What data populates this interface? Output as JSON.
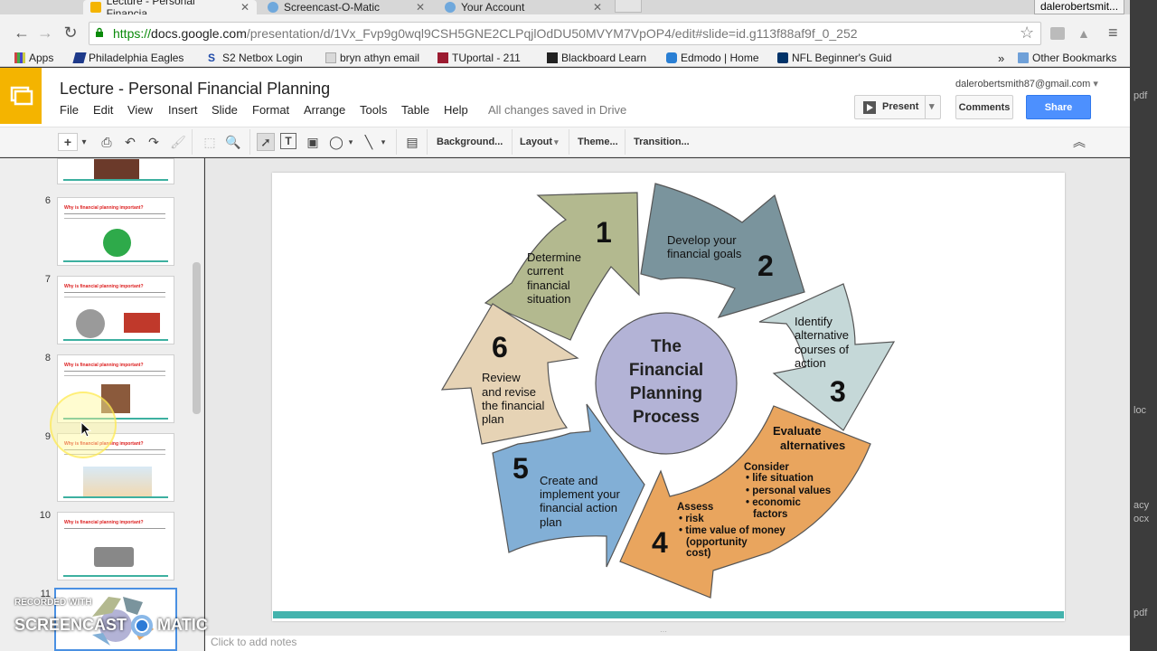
{
  "browser": {
    "tabs": [
      {
        "label": "Lecture - Personal Financia",
        "active": true
      },
      {
        "label": "Screencast-O-Matic",
        "active": false
      },
      {
        "label": "Your Account",
        "active": false
      }
    ],
    "profile": "dalerobertsmit...",
    "url": {
      "scheme": "https://",
      "host": "docs.google.com",
      "path": "/presentation/d/1Vx_Fvp9g0wql9CSH5GNE2CLPqjlOdDU50MVYM7VpOP4/edit#slide=id.g113f88af9f_0_252"
    },
    "bookmarks": [
      "Apps",
      "Philadelphia Eagles",
      "S2 Netbox Login",
      "bryn athyn email",
      "TUportal - 211",
      "Blackboard Learn",
      "Edmodo | Home",
      "NFL Beginner's Guid",
      "Other Bookmarks"
    ],
    "overflow": "»"
  },
  "app": {
    "title": "Lecture - Personal Financial Planning",
    "menus": [
      "File",
      "Edit",
      "View",
      "Insert",
      "Slide",
      "Format",
      "Arrange",
      "Tools",
      "Table",
      "Help"
    ],
    "saved_status": "All changes saved in Drive",
    "account": "dalerobertsmith87@gmail.com",
    "present": "Present",
    "comments": "Comments",
    "share": "Share",
    "toolbar": {
      "background": "Background...",
      "layout": "Layout",
      "theme": "Theme...",
      "transition": "Transition..."
    }
  },
  "filmstrip": {
    "slides": [
      {
        "num": "6",
        "title": "Why is financial planning important?"
      },
      {
        "num": "7",
        "title": "Why is financial planning important?"
      },
      {
        "num": "8",
        "title": "Why is financial planning important?"
      },
      {
        "num": "9",
        "title": "Why is financial planning important?"
      },
      {
        "num": "10",
        "title": "Why is financial planning important?"
      },
      {
        "num": "11",
        "title": ""
      }
    ]
  },
  "diagram": {
    "center": [
      "The",
      "Financial",
      "Planning",
      "Process"
    ],
    "steps": [
      {
        "num": "1",
        "lines": [
          "Determine",
          "current",
          "financial",
          "situation"
        ],
        "color": "#b3b98f"
      },
      {
        "num": "2",
        "lines": [
          "Develop your",
          "financial goals"
        ],
        "color": "#7a949d"
      },
      {
        "num": "3",
        "lines": [
          "Identify",
          "alternative",
          "courses of",
          "action"
        ],
        "color": "#c5d8d8"
      },
      {
        "num": "4",
        "lines": [
          "Evaluate",
          "alternatives"
        ],
        "color": "#e9a55e"
      },
      {
        "num": "5",
        "lines": [
          "Create and",
          "implement your",
          "financial action",
          "plan"
        ],
        "color": "#82afd6"
      },
      {
        "num": "6",
        "lines": [
          "Review",
          "and revise",
          "the financial",
          "plan"
        ],
        "color": "#e6d3b5"
      }
    ],
    "consider_title": "Consider",
    "consider_items": [
      "life situation",
      "personal values",
      "economic",
      "factors"
    ],
    "assess_title": "Assess",
    "assess_items": [
      "risk",
      "time value of money",
      "(opportunity",
      "cost)"
    ]
  },
  "notes_placeholder": "Click to add notes",
  "watermark": {
    "recorded": "RECORDED WITH",
    "brand": "SCREENCAST",
    "brand2": "MATIC"
  },
  "rightpane": [
    "pdf",
    "loc",
    "acy",
    "ocx",
    "pdf"
  ],
  "colors": {
    "accent": "#4d90fe",
    "slides_yellow": "#f4b400",
    "teal": "#43b3ad"
  }
}
